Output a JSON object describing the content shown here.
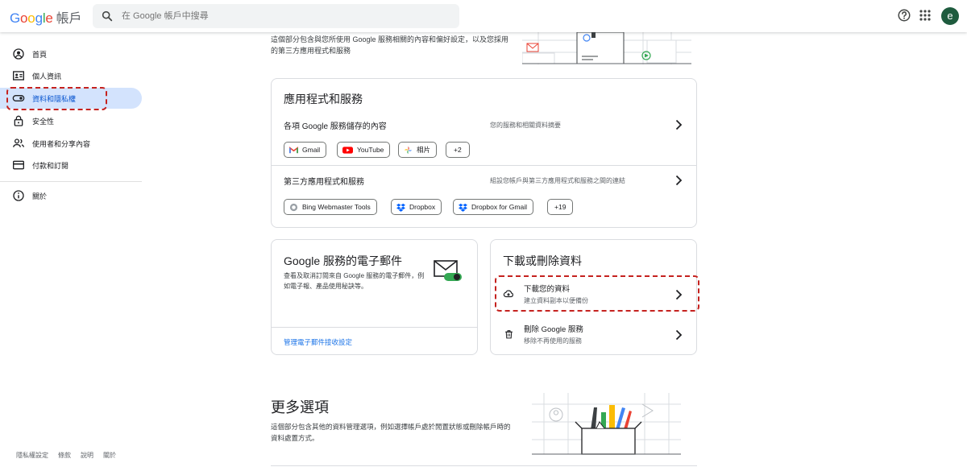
{
  "header": {
    "logo_letters": [
      "G",
      "o",
      "o",
      "g",
      "l",
      "e"
    ],
    "account_label": "帳戶",
    "search_placeholder": "在 Google 帳戶中搜尋",
    "avatar_letter": "e"
  },
  "sidebar": {
    "items": [
      {
        "label": "首頁",
        "icon": "home-icon"
      },
      {
        "label": "個人資訊",
        "icon": "person-card-icon"
      },
      {
        "label": "資料和隱私權",
        "icon": "toggle-icon",
        "active": true
      },
      {
        "label": "安全性",
        "icon": "lock-icon"
      },
      {
        "label": "使用者和分享內容",
        "icon": "people-icon"
      },
      {
        "label": "付款和訂閱",
        "icon": "credit-card-icon"
      },
      {
        "label": "關於",
        "icon": "info-icon"
      }
    ],
    "footer": [
      "隱私權設定",
      "條款",
      "說明",
      "關於"
    ]
  },
  "intro": {
    "text": "這個部分包含與您所使用 Google 服務相關的內容和偏好設定，以及您採用的第三方應用程式和服務"
  },
  "apps_card": {
    "title": "應用程式和服務",
    "google_row": {
      "title": "各項 Google 服務儲存的內容",
      "desc": "您的服務和相關資料摘要"
    },
    "google_chips": [
      "Gmail",
      "YouTube",
      "相片",
      "+2"
    ],
    "third_row": {
      "title": "第三方應用程式和服務",
      "desc": "組設您帳戶與第三方應用程式和服務之間的連結"
    },
    "third_chips": [
      "Bing Webmaster Tools",
      "Dropbox",
      "Dropbox for Gmail",
      "+19"
    ]
  },
  "email_card": {
    "title": "Google 服務的電子郵件",
    "body": "查看及取消訂閱來自 Google 服務的電子郵件，例如電子報、產品使用秘訣等。",
    "link": "管理電子郵件接收設定"
  },
  "download_card": {
    "title": "下載或刪除資料",
    "download": {
      "title": "下載您的資料",
      "desc": "建立資料副本以便備份"
    },
    "delete": {
      "title": "刪除 Google 服務",
      "desc": "移除不再使用的服務"
    }
  },
  "more": {
    "title": "更多選項",
    "body": "這個部分包含其他的資料管理選項，例如選擇帳戶處於閒置狀態或刪除帳戶時的資料處置方式。"
  },
  "colors": {
    "accent": "#0b57d0",
    "active_bg": "#d3e3fd",
    "dash": "#c5221f",
    "link": "#1a73e8"
  }
}
